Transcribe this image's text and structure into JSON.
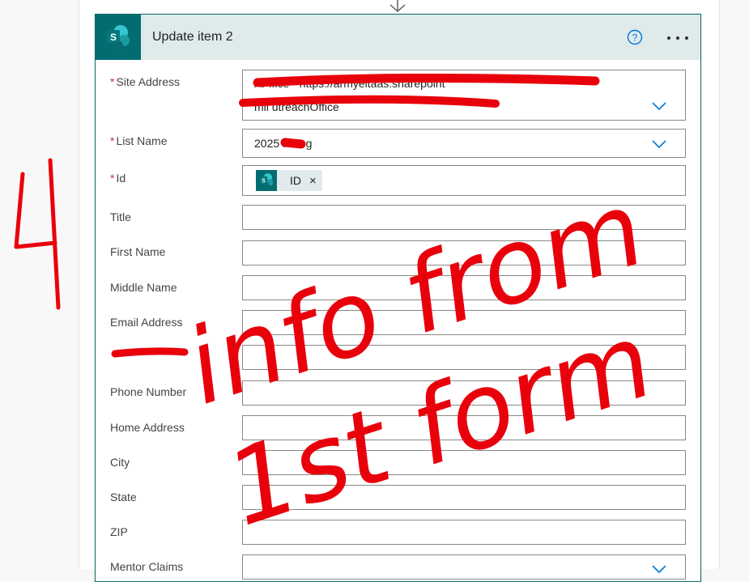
{
  "card": {
    "title": "Update item 2",
    "help_icon": "help-circle-icon",
    "more_icon": "more-dots-icon",
    "app_icon": "sharepoint-icon"
  },
  "fields": {
    "site_address": {
      "label": "Site Address",
      "line1": "Ar                        ffice - https://armyeitaas.sharepoint",
      "line2": "mil                                   utreachOffice",
      "required": "*"
    },
    "list_name": {
      "label": "List Name",
      "value": "2025      P Log",
      "required": "*"
    },
    "id": {
      "label": "Id",
      "token": "ID",
      "token_remove": "×",
      "required": "*"
    },
    "title": {
      "label": "Title"
    },
    "first_name": {
      "label": "First Name"
    },
    "middle_name": {
      "label": "Middle Name"
    },
    "email": {
      "label": "Email Address"
    },
    "phone": {
      "label": "Phone Number"
    },
    "home_address": {
      "label": "Home Address"
    },
    "city": {
      "label": "City"
    },
    "state": {
      "label": "State"
    },
    "zip": {
      "label": "ZIP"
    },
    "mentor_claims": {
      "label": "Mentor Claims"
    }
  },
  "annotation": {
    "number": "4",
    "line1": "info from",
    "line2": "1st form",
    "color": "#e8000b"
  },
  "colors": {
    "sharepoint_teal": "#036c70",
    "header_bg": "#dfeaeb",
    "link_blue": "#0078d4",
    "required_red": "#c4314b"
  }
}
